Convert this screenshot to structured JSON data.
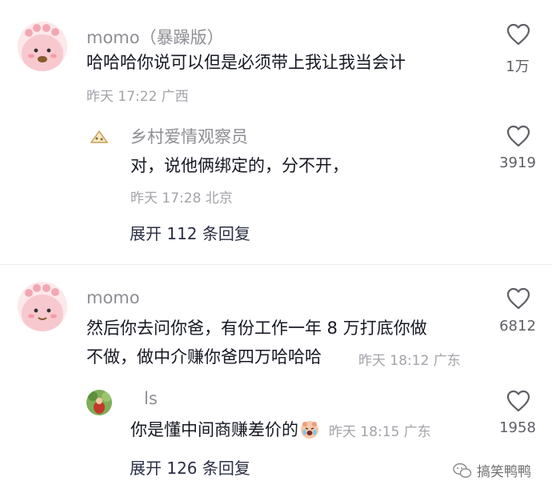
{
  "comments": [
    {
      "username": "momo（暴躁版）",
      "text": "哈哈哈你说可以但是必须带上我让我当会计",
      "meta": "昨天 17:22 广西",
      "likes": "1万",
      "reply": {
        "username": "乡村爱情观察员",
        "text": "对，说他俩绑定的，分不开，",
        "meta": "昨天 17:28 北京",
        "likes": "3919"
      },
      "expand": "展开 112 条回复"
    },
    {
      "username": "momo",
      "text_line1": "然后你去问你爸，有份工作一年 8 万打底你做",
      "text_line2": "不做，做中介赚你爸四万哈哈哈",
      "meta": "昨天 18:12 广东",
      "likes": "6812",
      "reply": {
        "username": "ls",
        "text": "你是懂中间商赚差价的",
        "meta": "昨天 18:15 广东",
        "likes": "1958"
      },
      "expand": "展开 126 条回复"
    }
  ],
  "watermark": "搞笑鸭鸭",
  "icons": {
    "like": "heart-outline-icon",
    "emoji": "crying-face-emoji",
    "wechat": "wechat-logo-icon"
  }
}
